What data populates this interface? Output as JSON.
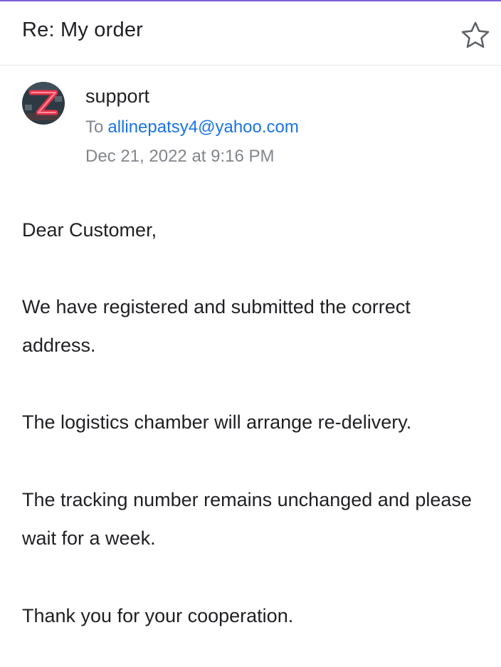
{
  "email": {
    "subject": "Re: My order",
    "sender": "support",
    "to_label": "To",
    "to_address": "allinepatsy4@yahoo.com",
    "date": "Dec 21, 2022 at 9:16 PM"
  },
  "icons": {
    "star": "star-outline-icon",
    "avatar_letter": "Z"
  },
  "colors": {
    "link": "#1a73e8",
    "accent": "#7b61d9",
    "avatar_red": "#e8334a"
  },
  "body": {
    "greeting": "Dear Customer,",
    "p1": "We have registered and submitted the correct address.",
    "p2": "The logistics chamber will arrange re-delivery.",
    "p3": "The tracking number remains unchanged and please wait for a week.",
    "p4": "Thank you for your cooperation."
  }
}
